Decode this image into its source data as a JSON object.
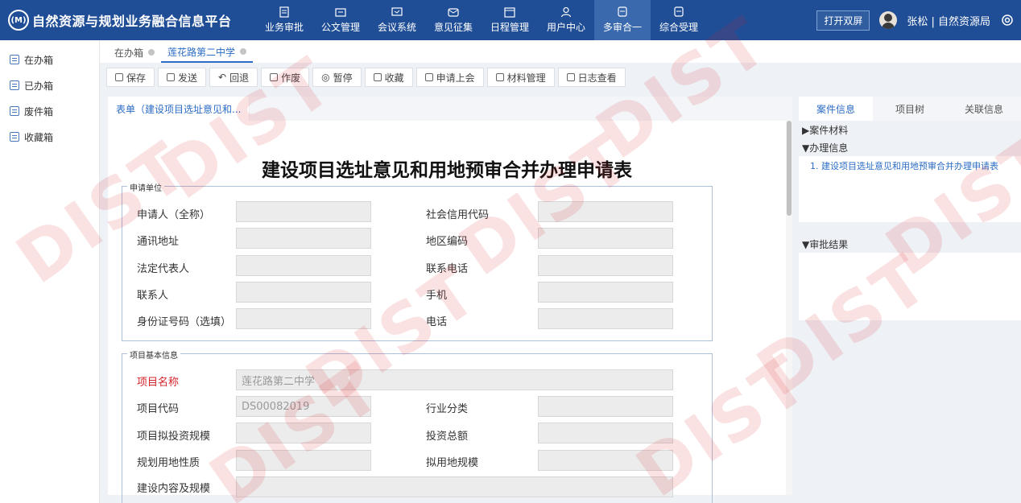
{
  "header": {
    "logo_mark": "(M)",
    "title": "自然资源与规划业务融合信息平台",
    "nav": [
      {
        "label": "业务审批",
        "icon": "doc-check-icon"
      },
      {
        "label": "公文管理",
        "icon": "folder-icon"
      },
      {
        "label": "会议系统",
        "icon": "meeting-icon"
      },
      {
        "label": "意见征集",
        "icon": "mail-icon"
      },
      {
        "label": "日程管理",
        "icon": "calendar-icon"
      },
      {
        "label": "用户中心",
        "icon": "user-icon"
      },
      {
        "label": "多审合一",
        "icon": "layers-icon"
      },
      {
        "label": "综合受理",
        "icon": "inbox-icon"
      }
    ],
    "dual_screen": "打开双屏",
    "user": "张松 | 自然资源局"
  },
  "sidebar": {
    "items": [
      "在办箱",
      "已办箱",
      "废件箱",
      "收藏箱"
    ]
  },
  "tabs": [
    "在办箱",
    "莲花路第二中学"
  ],
  "toolbar": [
    "保存",
    "发送",
    "回退",
    "作废",
    "暂停",
    "收藏",
    "申请上会",
    "材料管理",
    "日志查看"
  ],
  "form": {
    "tab": "表单（建设项目选址意见和...",
    "title": "建设项目选址意见和用地预审合并办理申请表",
    "section1": {
      "legend": "申请单位",
      "left_labels": [
        "申请人（全称）",
        "通讯地址",
        "法定代表人",
        "联系人",
        "身份证号码（选填）"
      ],
      "right_labels": [
        "社会信用代码",
        "地区编码",
        "联系电话",
        "手机",
        "电话"
      ]
    },
    "section2": {
      "legend": "项目基本信息",
      "project_name_label": "项目名称",
      "project_name_value": "莲花路第二中学",
      "project_code_label": "项目代码",
      "project_code_value": "DS00082019",
      "industry_label": "行业分类",
      "invest_scale_label": "项目拟投资规模",
      "invest_total_label": "投资总额",
      "land_nature_label": "规划用地性质",
      "land_scale_label": "拟用地规模",
      "content_label": "建设内容及规模"
    }
  },
  "right_panel": {
    "tabs": [
      "案件信息",
      "项目树",
      "关联信息"
    ],
    "case_material": "▶案件材料",
    "handle_info": "▼办理信息",
    "handle_link": "1. 建设项目选址意见和用地预审合并办理申请表",
    "approval_result": "▼审批结果"
  },
  "watermark": "DIST"
}
